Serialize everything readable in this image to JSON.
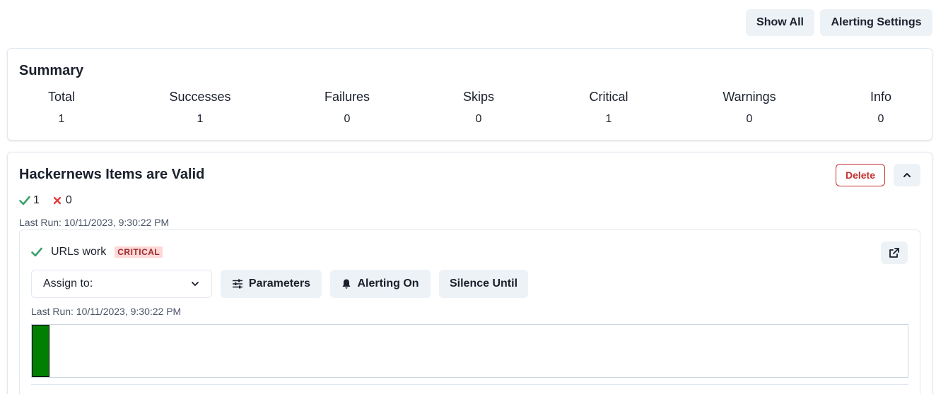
{
  "toolbar": {
    "show_all": "Show All",
    "alerting_settings": "Alerting Settings"
  },
  "summary": {
    "title": "Summary",
    "stats": [
      {
        "label": "Total",
        "value": "1"
      },
      {
        "label": "Successes",
        "value": "1"
      },
      {
        "label": "Failures",
        "value": "0"
      },
      {
        "label": "Skips",
        "value": "0"
      },
      {
        "label": "Critical",
        "value": "1"
      },
      {
        "label": "Warnings",
        "value": "0"
      },
      {
        "label": "Info",
        "value": "0"
      }
    ]
  },
  "suite": {
    "title": "Hackernews Items are Valid",
    "pass_count": "1",
    "fail_count": "0",
    "last_run": "Last Run: 10/11/2023, 9:30:22 PM",
    "delete_label": "Delete",
    "icons": {
      "collapse": "chevron-up-icon",
      "pass": "check-icon",
      "fail": "x-icon"
    },
    "test": {
      "name": "URLs work",
      "severity": "CRITICAL",
      "assign_placeholder": "Assign to:",
      "parameters_label": "Parameters",
      "alerting_label": "Alerting On",
      "silence_label": "Silence Until",
      "last_run": "Last Run: 10/11/2023, 9:30:22 PM",
      "icons": {
        "external": "external-link-icon",
        "parameters": "sliders-icon",
        "alerting": "bell-icon",
        "dropdown": "chevron-down-icon"
      },
      "history": [
        {
          "status": "pass"
        }
      ]
    }
  },
  "colors": {
    "pass": "#38a169",
    "fail": "#e53e3e",
    "history_pass": "#008000",
    "danger": "#c53030",
    "badge_bg": "#fed7d7"
  }
}
